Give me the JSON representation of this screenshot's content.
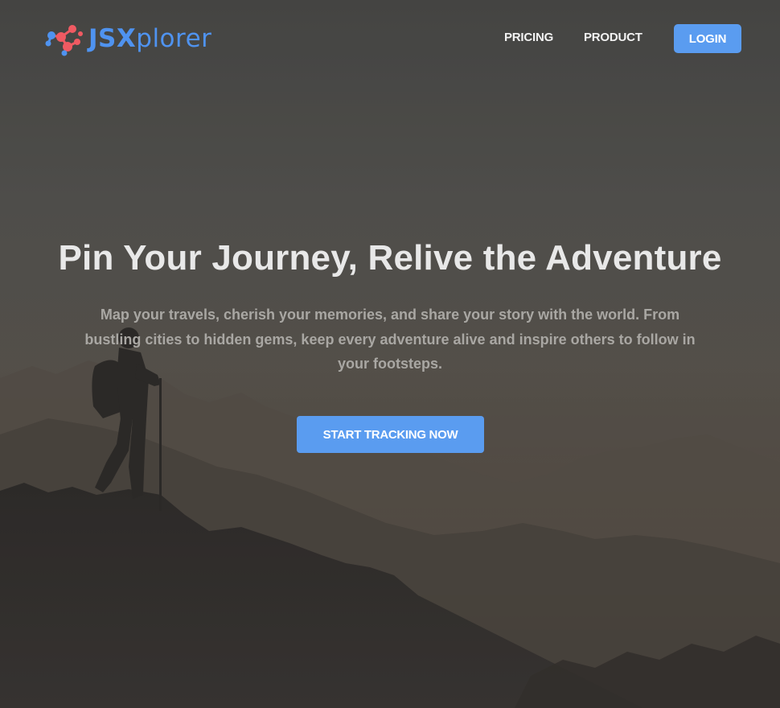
{
  "header": {
    "logo": {
      "text_part1": "JSX",
      "text_part2": "plorer",
      "icon": "molecule-logo-icon"
    },
    "nav": {
      "pricing": "PRICING",
      "product": "PRODUCT",
      "login": "LOGIN"
    }
  },
  "hero": {
    "title": "Pin Your Journey, Relive the Adventure",
    "subtitle": "Map your travels, cherish your memories, and share your story with the world. From bustling cities to hidden gems, keep every adventure alive and inspire others to follow in your footsteps.",
    "cta_label": "START TRACKING NOW"
  },
  "colors": {
    "accent": "#5a9cf0",
    "logo_blue": "#4f93f0",
    "logo_coral": "#f05a62"
  }
}
